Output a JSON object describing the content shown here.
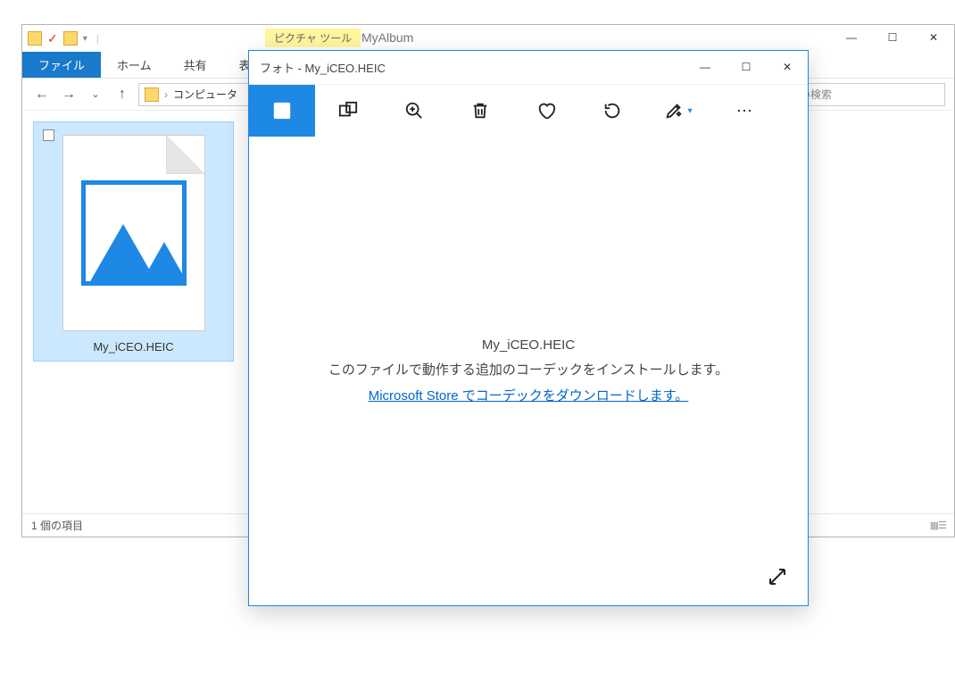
{
  "explorer": {
    "picture_tools": "ピクチャ ツール",
    "album_title": "MyAlbum",
    "tabs": {
      "file": "ファイル",
      "home": "ホーム",
      "share": "共有",
      "view": "表示"
    },
    "breadcrumb": "コンピュータ",
    "search_placeholder": "の検索",
    "file_name": "My_iCEO.HEIC",
    "status": "1 個の項目"
  },
  "photos": {
    "title": "フォト - My_iCEO.HEIC",
    "filename": "My_iCEO.HEIC",
    "message": "このファイルで動作する追加のコーデックをインストールします。",
    "link": "Microsoft Store でコーデックをダウンロードします。"
  }
}
